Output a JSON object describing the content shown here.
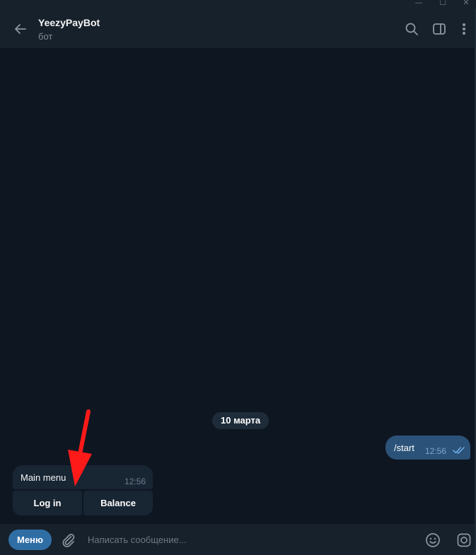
{
  "window": {
    "minimize_glyph": "—",
    "maximize_glyph": "☐",
    "close_glyph": "✕"
  },
  "header": {
    "title": "YeezyPayBot",
    "subtitle": "бот",
    "icons": [
      "back-arrow-icon",
      "search-icon",
      "side-panel-icon",
      "more-vertical-icon"
    ]
  },
  "chat": {
    "date_chip": "10 марта",
    "outgoing": {
      "text": "/start",
      "time": "12:56",
      "status_icon": "double-check-icon"
    },
    "incoming": {
      "text": "Main menu",
      "time": "12:56",
      "keyboard": [
        {
          "label": "Log in"
        },
        {
          "label": "Balance"
        }
      ]
    }
  },
  "composer": {
    "menu_label": "Меню",
    "placeholder": "Написать сообщение...",
    "icons": [
      "paperclip-icon",
      "emoji-icon",
      "instant-camera-icon"
    ]
  },
  "colors": {
    "background": "#0e1621",
    "panel": "#17212b",
    "outgoing_bubble": "#2b5278",
    "incoming_bubble": "#182533",
    "accent": "#2f6ea5",
    "annotation": "#ff1a1a"
  }
}
